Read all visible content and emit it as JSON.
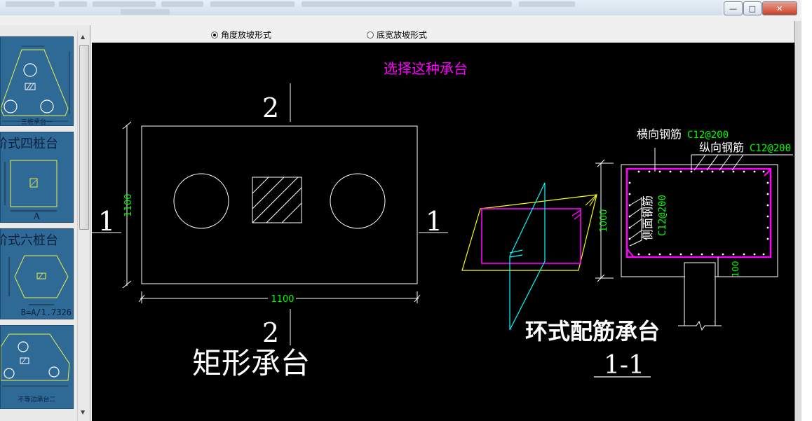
{
  "window": {
    "controls": {
      "minimize": "—",
      "maximize": "□",
      "close": "✕"
    }
  },
  "thumbnails": [
    {
      "name": "thumb-three-pile",
      "caption": "三桩承台一",
      "title": ""
    },
    {
      "name": "thumb-four-pile",
      "caption": "",
      "title": "阶式四桩台",
      "label": "A"
    },
    {
      "name": "thumb-six-pile",
      "caption": "",
      "title": "阶式六桩台",
      "label": "B=A/1.7326"
    },
    {
      "name": "thumb-unequal",
      "caption": "不等边承台二",
      "title": ""
    }
  ],
  "options": {
    "angle": "角度放坡形式",
    "width": "底宽放坡形式",
    "selected": "angle"
  },
  "drawing": {
    "prompt": "选择这种承台",
    "rect": {
      "title": "矩形承台",
      "dim_width": "1100",
      "dim_height": "1100",
      "section_top": "2",
      "section_bottom": "2",
      "section_left": "1",
      "section_right": "1"
    },
    "ring": {
      "title": "环式配筋承台",
      "section": "1-1",
      "transverse_label": "横向钢筋",
      "transverse_spec": "C12@200",
      "longitudinal_label": "纵向钢筋",
      "longitudinal_spec": "C12@200",
      "side_label": "侧面钢筋",
      "side_spec": "C12@200",
      "dim_height": "1000",
      "dim_cover": "100"
    }
  },
  "colors": {
    "canvas_bg": "#000000",
    "line_white": "#ffffff",
    "dim_green": "#00ff00",
    "magenta": "#ff00ff",
    "yellow": "#ffff00",
    "cyan": "#00ffff",
    "thumb_bg": "#2f6a96"
  }
}
